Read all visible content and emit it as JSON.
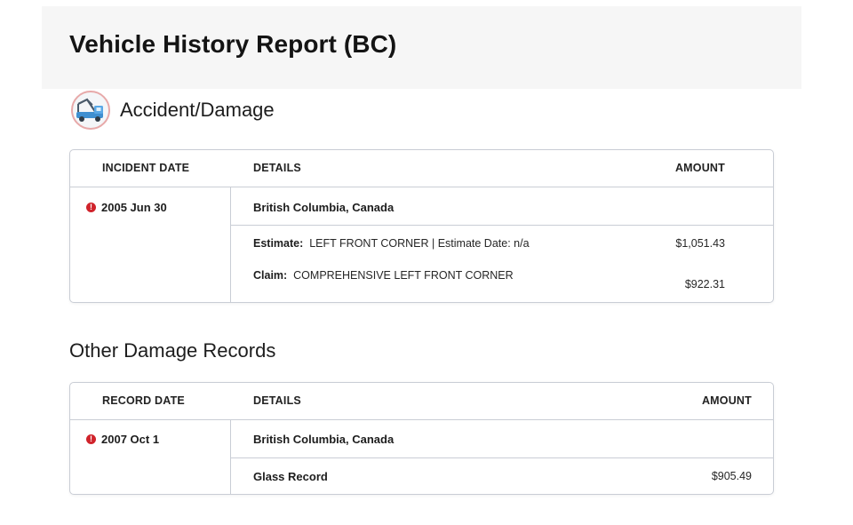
{
  "page": {
    "title": "Vehicle History Report (BC)"
  },
  "accident_section": {
    "title": "Accident/Damage",
    "icon": "tow-truck-icon",
    "headers": {
      "date": "INCIDENT DATE",
      "details": "DETAILS",
      "amount": "AMOUNT"
    },
    "record": {
      "date": "2005 Jun 30",
      "location": "British Columbia, Canada",
      "estimate_label": "Estimate:",
      "estimate_text": "LEFT FRONT CORNER | Estimate Date: n/a",
      "estimate_amount": "$1,051.43",
      "claim_label": "Claim:",
      "claim_text": "COMPREHENSIVE LEFT FRONT CORNER",
      "claim_amount": "$922.31"
    }
  },
  "other_section": {
    "title": "Other Damage Records",
    "headers": {
      "date": "RECORD DATE",
      "details": "DETAILS",
      "amount": "AMOUNT"
    },
    "record": {
      "date": "2007 Oct 1",
      "location": "British Columbia, Canada",
      "item_label": "Glass Record",
      "item_amount": "$905.49"
    }
  },
  "colors": {
    "alert": "#d0232b",
    "border": "#c9cdd5",
    "header_band": "#f6f6f6"
  }
}
